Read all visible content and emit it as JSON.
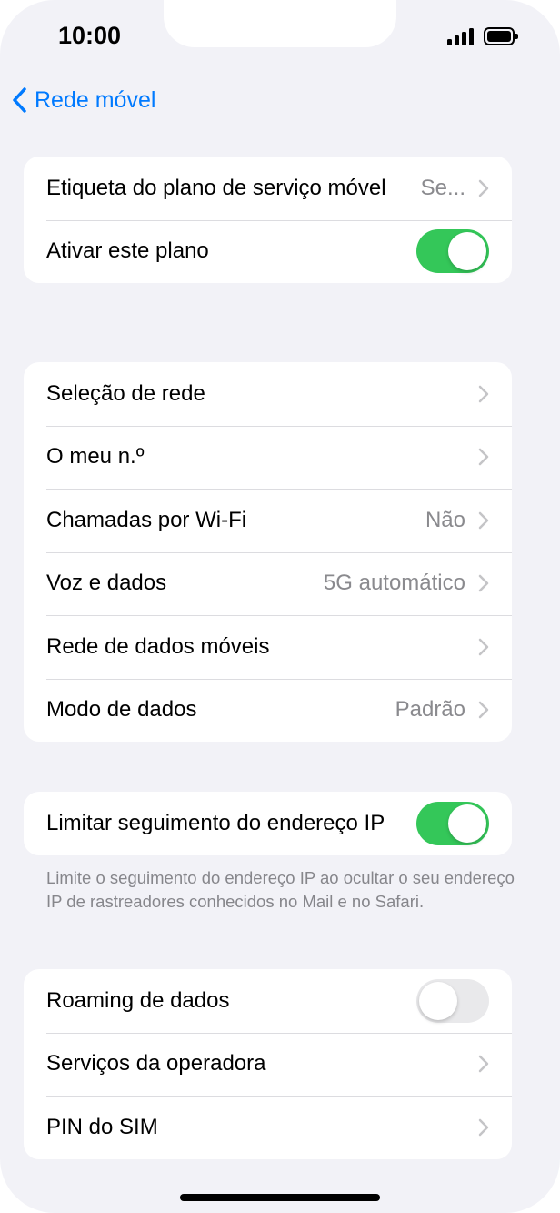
{
  "status_bar": {
    "time": "10:00"
  },
  "nav": {
    "back_label": "Rede móvel"
  },
  "group1": {
    "plan_label": {
      "title": "Etiqueta do plano de serviço móvel",
      "value": "Se..."
    },
    "activate": {
      "title": "Ativar este plano",
      "toggle": "on"
    }
  },
  "group2": {
    "items": [
      {
        "title": "Seleção de rede",
        "value": ""
      },
      {
        "title": "O meu n.º",
        "value": ""
      },
      {
        "title": "Chamadas por Wi-Fi",
        "value": "Não"
      },
      {
        "title": "Voz e dados",
        "value": "5G automático"
      },
      {
        "title": "Rede de dados móveis",
        "value": ""
      },
      {
        "title": "Modo de dados",
        "value": "Padrão"
      }
    ]
  },
  "group3": {
    "limit_ip": {
      "title": "Limitar seguimento do endereço IP",
      "toggle": "on"
    },
    "footnote": "Limite o seguimento do endereço IP ao ocultar o seu endereço IP de rastreadores conhecidos no Mail e no Safari."
  },
  "group4": {
    "roaming": {
      "title": "Roaming de dados",
      "toggle": "off"
    },
    "carrier_services": {
      "title": "Serviços da operadora"
    },
    "sim_pin": {
      "title": "PIN do SIM"
    }
  },
  "colors": {
    "accent": "#007aff",
    "toggle_on": "#34c759",
    "background": "#f2f2f7"
  }
}
